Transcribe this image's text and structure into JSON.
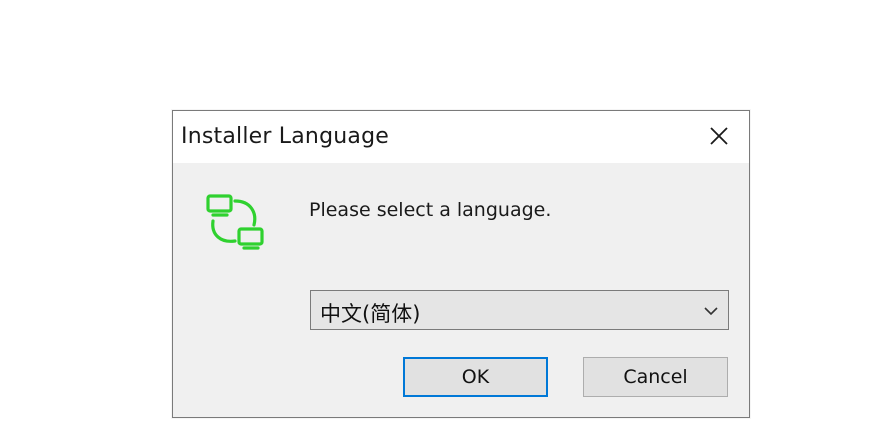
{
  "dialog": {
    "title": "Installer Language",
    "prompt": "Please select a language.",
    "language_select": {
      "selected": "中文(简体)"
    },
    "ok_label": "OK",
    "cancel_label": "Cancel",
    "icons": {
      "close": "close-icon",
      "app": "network-computers-icon",
      "dropdown": "chevron-down-icon"
    },
    "colors": {
      "icon_green": "#2fd12f",
      "focus_blue": "#0078d7"
    }
  }
}
